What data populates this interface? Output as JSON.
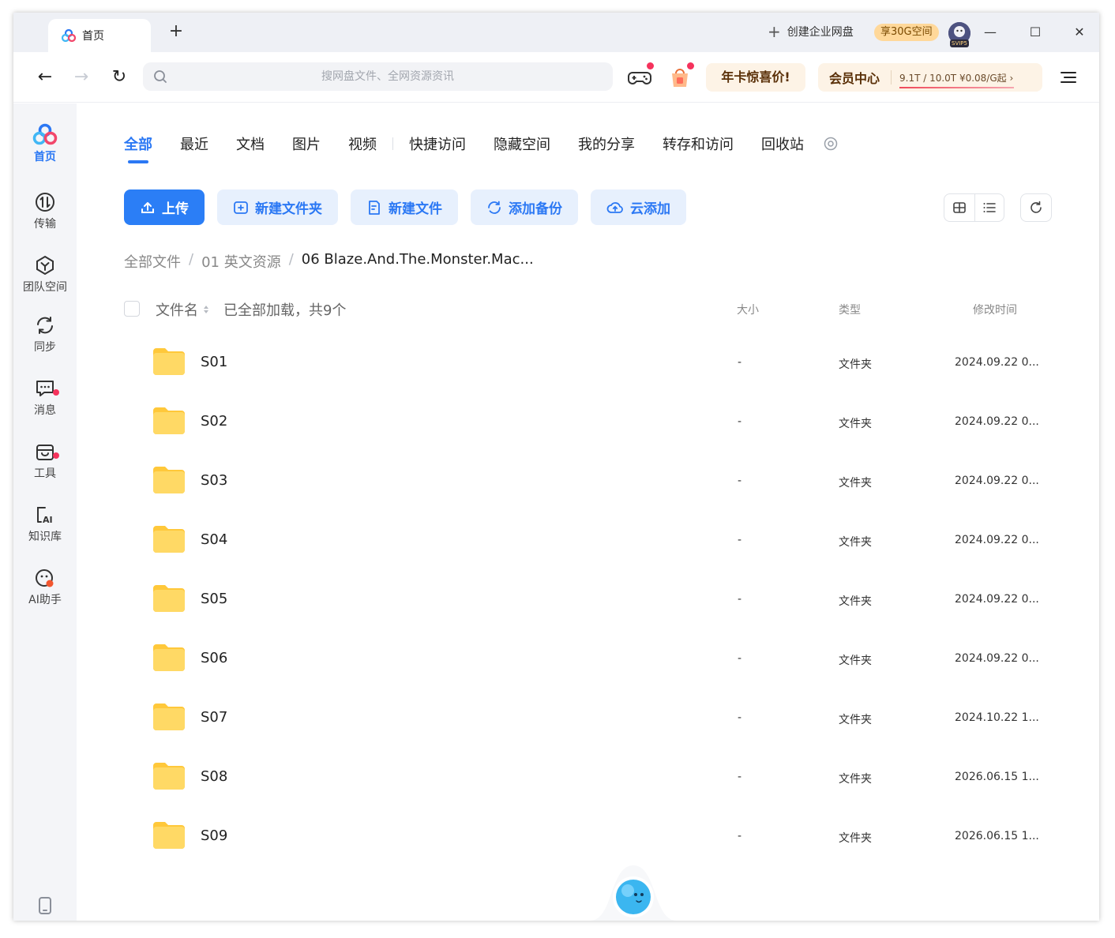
{
  "titlebar": {
    "tab_label": "首页",
    "new_tab": "+",
    "create_enterprise": "创建企业网盘",
    "promo_badge": "享30G空间",
    "avatar_badge": "SVIP5",
    "controls": {
      "minimize": "—",
      "maximize": "☐",
      "close": "✕"
    }
  },
  "toolbar": {
    "back": "←",
    "forward": "→",
    "reload": "↻",
    "search_placeholder": "搜网盘文件、全网资源资讯",
    "promo_label": "年卡惊喜价!",
    "vip_title": "会员中心",
    "vip_info": "9.1T / 10.0T   ¥0.08/G起 ›"
  },
  "sidebar": {
    "items": [
      {
        "label": "首页",
        "icon": "logo-icon",
        "active": true
      },
      {
        "label": "传输",
        "icon": "transfer-icon"
      },
      {
        "label": "团队空间",
        "icon": "team-space-icon"
      },
      {
        "label": "同步",
        "icon": "sync-icon"
      },
      {
        "label": "消息",
        "icon": "message-icon",
        "dot": true
      },
      {
        "label": "工具",
        "icon": "tools-icon",
        "dot": true
      },
      {
        "label": "知识库",
        "icon": "knowledge-base-icon"
      },
      {
        "label": "AI助手",
        "icon": "ai-assistant-icon"
      }
    ],
    "bottom_icon": "phone-icon"
  },
  "main": {
    "categories": [
      "全部",
      "最近",
      "文档",
      "图片",
      "视频",
      "快捷访问",
      "隐藏空间",
      "我的分享",
      "转存和访问",
      "回收站"
    ],
    "actions": {
      "upload": "上传",
      "new_folder": "新建文件夹",
      "new_file": "新建文件",
      "add_backup": "添加备份",
      "cloud_add": "云添加"
    },
    "breadcrumb": [
      "全部文件",
      "01 英文资源",
      "06 Blaze.And.The.Monster.Mac..."
    ],
    "header": {
      "name": "文件名",
      "loaded": "已全部加载，共9个",
      "size": "大小",
      "type": "类型",
      "modified": "修改时间"
    },
    "files": [
      {
        "name": "S01",
        "size": "-",
        "type": "文件夹",
        "modified": "2024.09.22 0..."
      },
      {
        "name": "S02",
        "size": "-",
        "type": "文件夹",
        "modified": "2024.09.22 0..."
      },
      {
        "name": "S03",
        "size": "-",
        "type": "文件夹",
        "modified": "2024.09.22 0..."
      },
      {
        "name": "S04",
        "size": "-",
        "type": "文件夹",
        "modified": "2024.09.22 0..."
      },
      {
        "name": "S05",
        "size": "-",
        "type": "文件夹",
        "modified": "2024.09.22 0..."
      },
      {
        "name": "S06",
        "size": "-",
        "type": "文件夹",
        "modified": "2024.09.22 0..."
      },
      {
        "name": "S07",
        "size": "-",
        "type": "文件夹",
        "modified": "2024.10.22 1..."
      },
      {
        "name": "S08",
        "size": "-",
        "type": "文件夹",
        "modified": "2026.06.15 1..."
      },
      {
        "name": "S09",
        "size": "-",
        "type": "文件夹",
        "modified": "2026.06.15 1..."
      }
    ]
  },
  "colors": {
    "accent": "#2b78f4",
    "folder": "#ffc83a",
    "badge": "#ffd89a",
    "dot": "#f5325c"
  }
}
